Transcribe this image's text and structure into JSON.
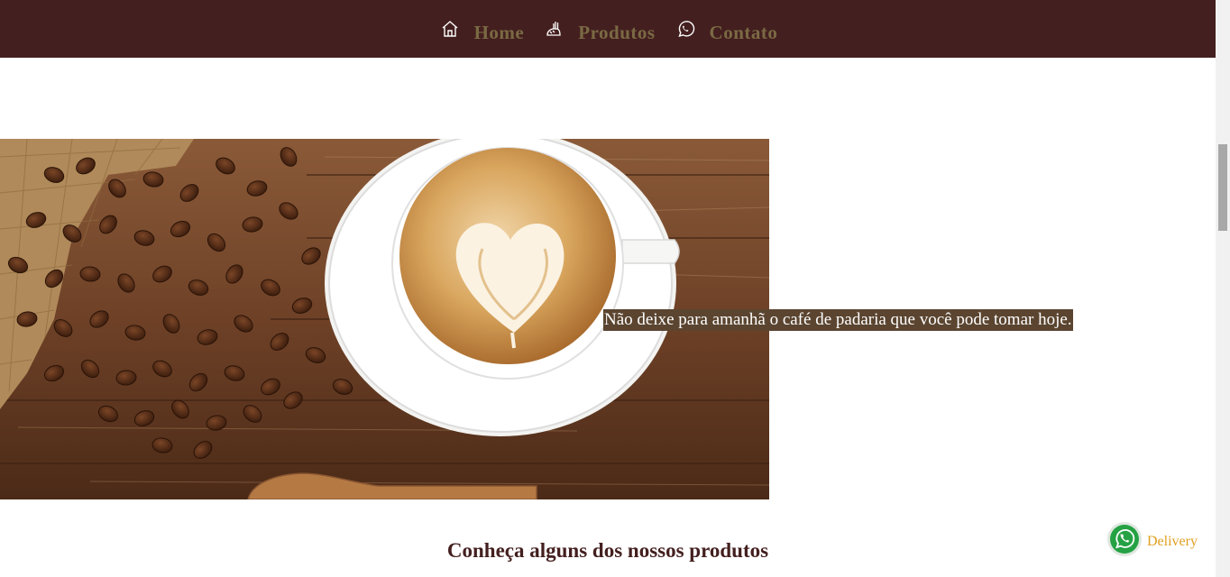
{
  "nav": {
    "items": [
      {
        "label": "Home",
        "icon": "home-icon"
      },
      {
        "label": "Produtos",
        "icon": "bread-icon"
      },
      {
        "label": "Contato",
        "icon": "whatsapp-icon"
      }
    ]
  },
  "hero": {
    "image": "coffee-latte-art-image",
    "text": "Não deixe para amanhã o café de padaria que você pode tomar hoje."
  },
  "products": {
    "title": "Conheça alguns dos nossos produtos"
  },
  "delivery": {
    "label": "Delivery",
    "icon": "whatsapp-icon"
  },
  "colors": {
    "navbar": "#441f1f",
    "nav_text": "#7a6a44",
    "hero_text_bg": "#5b4530",
    "delivery_text": "#e0a020",
    "whatsapp_green": "#25a244"
  }
}
